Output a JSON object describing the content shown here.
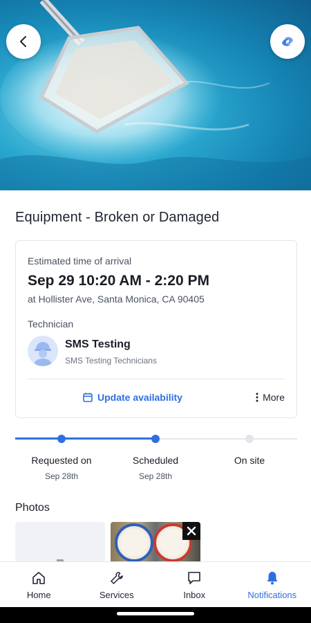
{
  "service": {
    "title": "Equipment - Broken or Damaged"
  },
  "eta": {
    "label": "Estimated time of arrival",
    "time": "Sep 29 10:20 AM - 2:20 PM",
    "address": "at Hollister Ave,  Santa Monica, CA 90405"
  },
  "technician": {
    "label": "Technician",
    "name": "SMS Testing",
    "team": "SMS Testing Technicians"
  },
  "actions": {
    "update_label": "Update availability",
    "more_label": "More"
  },
  "progress": {
    "steps": [
      {
        "label": "Requested on",
        "date": "Sep 28th",
        "status": "done"
      },
      {
        "label": "Scheduled",
        "date": "Sep 28th",
        "status": "done"
      },
      {
        "label": "On site",
        "date": "",
        "status": "pending"
      }
    ]
  },
  "photos": {
    "title": "Photos"
  },
  "tabs": [
    {
      "label": "Home",
      "icon": "home-icon",
      "active": false
    },
    {
      "label": "Services",
      "icon": "wrench-icon",
      "active": false
    },
    {
      "label": "Inbox",
      "icon": "chat-icon",
      "active": false
    },
    {
      "label": "Notifications",
      "icon": "bell-icon",
      "active": true
    }
  ],
  "colors": {
    "accent": "#2f6fe0",
    "text": "#1a1d26",
    "muted": "#4a5160",
    "border": "#e3e6eb"
  }
}
